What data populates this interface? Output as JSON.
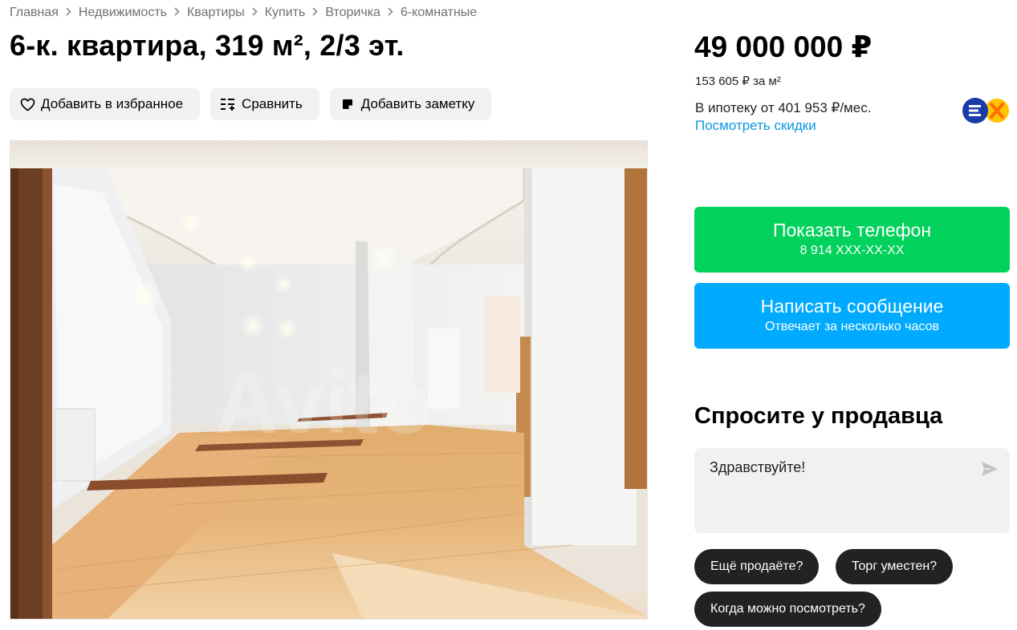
{
  "breadcrumb": [
    {
      "label": "Главная"
    },
    {
      "label": "Недвижимость"
    },
    {
      "label": "Квартиры"
    },
    {
      "label": "Купить"
    },
    {
      "label": "Вторичка"
    },
    {
      "label": "6-комнатные"
    }
  ],
  "listing": {
    "title": "6-к. квартира, 319 м², 2/3 эт."
  },
  "actions": {
    "favorite": "Добавить в избранное",
    "compare": "Сравнить",
    "note": "Добавить заметку"
  },
  "photo": {
    "description": "Interior photo of spacious room with wooden floor and curved ceiling",
    "watermark": "Avito"
  },
  "pricing": {
    "price": "49 000 000 ₽",
    "per_meter": "153 605 ₽ за м²",
    "mortgage": "В ипотеку от 401 953 ₽/мес.",
    "discounts_link": "Посмотреть скидки"
  },
  "contact": {
    "phone_label": "Показать телефон",
    "phone_number": "8 914 XXX-XX-XX",
    "message_label": "Написать сообщение",
    "message_sub": "Отвечает за несколько часов"
  },
  "ask": {
    "title": "Спросите у продавца",
    "message_text": "Здравствуйте!",
    "chips": [
      "Ещё продаёте?",
      "Торг уместен?",
      "Когда можно посмотреть?"
    ]
  },
  "colors": {
    "green": "#02d15c",
    "blue": "#00aaff",
    "link": "#0a97e0",
    "chip": "#222222"
  }
}
